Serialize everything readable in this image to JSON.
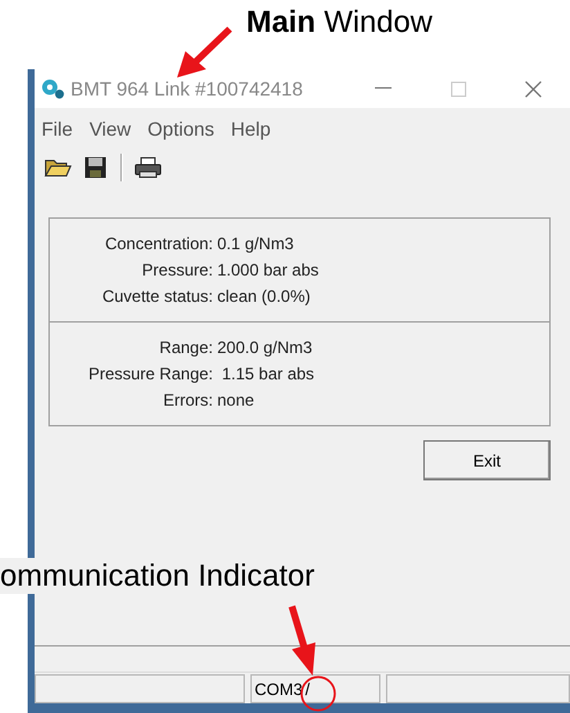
{
  "annotations": [
    {
      "kind": "main",
      "text": "**Main** Window"
    },
    {
      "kind": "indicator",
      "text": "ommunication Indicator"
    }
  ],
  "window": {
    "title": "BMT 964 Link #100742418"
  },
  "menu": [
    "File",
    "View",
    "Options",
    "Help"
  ],
  "readings": [
    {
      "label": "Concentration:",
      "value": "0.1 g/Nm3"
    },
    {
      "label": "Pressure:",
      "value": "1.000 bar abs"
    },
    {
      "label": "Cuvette status:",
      "value": "clean (0.0%)"
    }
  ],
  "settings": [
    {
      "label": "Range:",
      "value": "200.0 g/Nm3"
    },
    {
      "label": "Pressure Range:",
      "value": " 1.15 bar abs"
    },
    {
      "label": "Errors:",
      "value": "none"
    }
  ],
  "buttons": [
    "Exit"
  ],
  "status_bar": {
    "port": "COM3",
    "activity": "/"
  }
}
